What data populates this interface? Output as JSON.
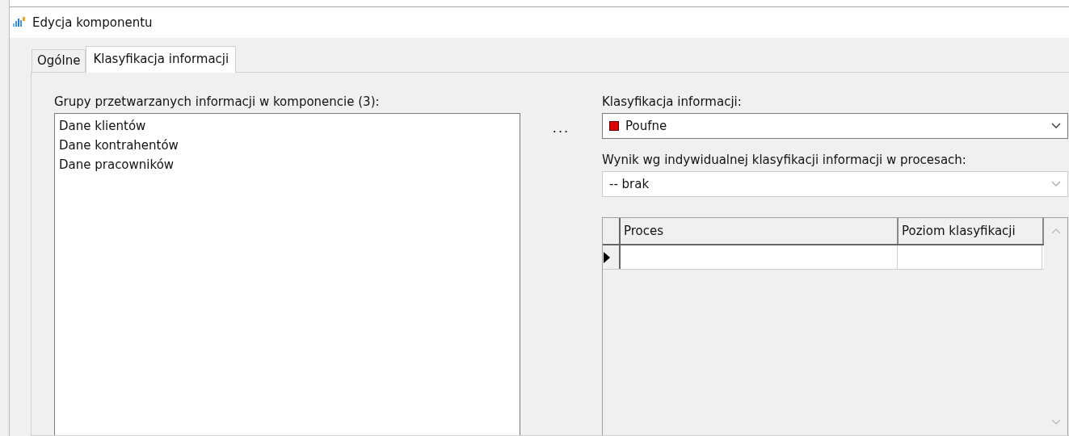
{
  "window": {
    "title": "Edycja komponentu"
  },
  "tabs": [
    {
      "label": "Ogólne",
      "selected": false
    },
    {
      "label": "Klasyfikacja informacji",
      "selected": true
    }
  ],
  "groups": {
    "label": "Grupy przetwarzanych informacji w komponencie (3):",
    "items": [
      "Dane klientów",
      "Dane kontrahentów",
      "Dane pracowników"
    ],
    "button": "..."
  },
  "classification": {
    "label": "Klasyfikacja informacji:",
    "value": "Poufne",
    "color": "#e00000"
  },
  "result": {
    "label": "Wynik wg indywidualnej klasyfikacji informacji w procesach:",
    "value": "-- brak",
    "disabled": true
  },
  "grid": {
    "columns": [
      "Proces",
      "Poziom klasyfikacji"
    ],
    "rows": [
      {
        "current": true
      }
    ]
  }
}
